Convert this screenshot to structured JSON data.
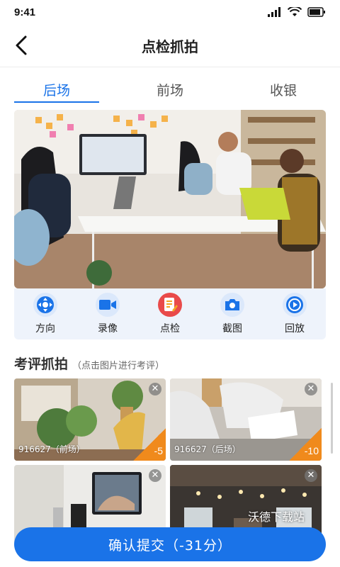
{
  "status": {
    "time": "9:41"
  },
  "nav": {
    "title": "点检抓拍"
  },
  "tabs": [
    {
      "label": "后场",
      "active": true
    },
    {
      "label": "前场",
      "active": false
    },
    {
      "label": "收银",
      "active": false
    }
  ],
  "controls": [
    {
      "label": "方向",
      "icon": "direction-icon"
    },
    {
      "label": "录像",
      "icon": "video-icon"
    },
    {
      "label": "点检",
      "icon": "inspect-icon"
    },
    {
      "label": "截图",
      "icon": "camera-icon"
    },
    {
      "label": "回放",
      "icon": "playback-icon"
    }
  ],
  "section": {
    "title": "考评抓拍",
    "hint": "（点击图片进行考评）"
  },
  "snapshots": [
    {
      "label": "916627（前场）",
      "score": "-5"
    },
    {
      "label": "916627（后场）",
      "score": "-10"
    },
    {
      "label": "",
      "score": ""
    },
    {
      "label": "",
      "score": ""
    }
  ],
  "watermark": "沃德下载站",
  "submit_label": "确认提交（-31分）",
  "colors": {
    "accent": "#1a73e8",
    "score_tag": "#f08a1c",
    "inspect": "#e94a4a"
  }
}
